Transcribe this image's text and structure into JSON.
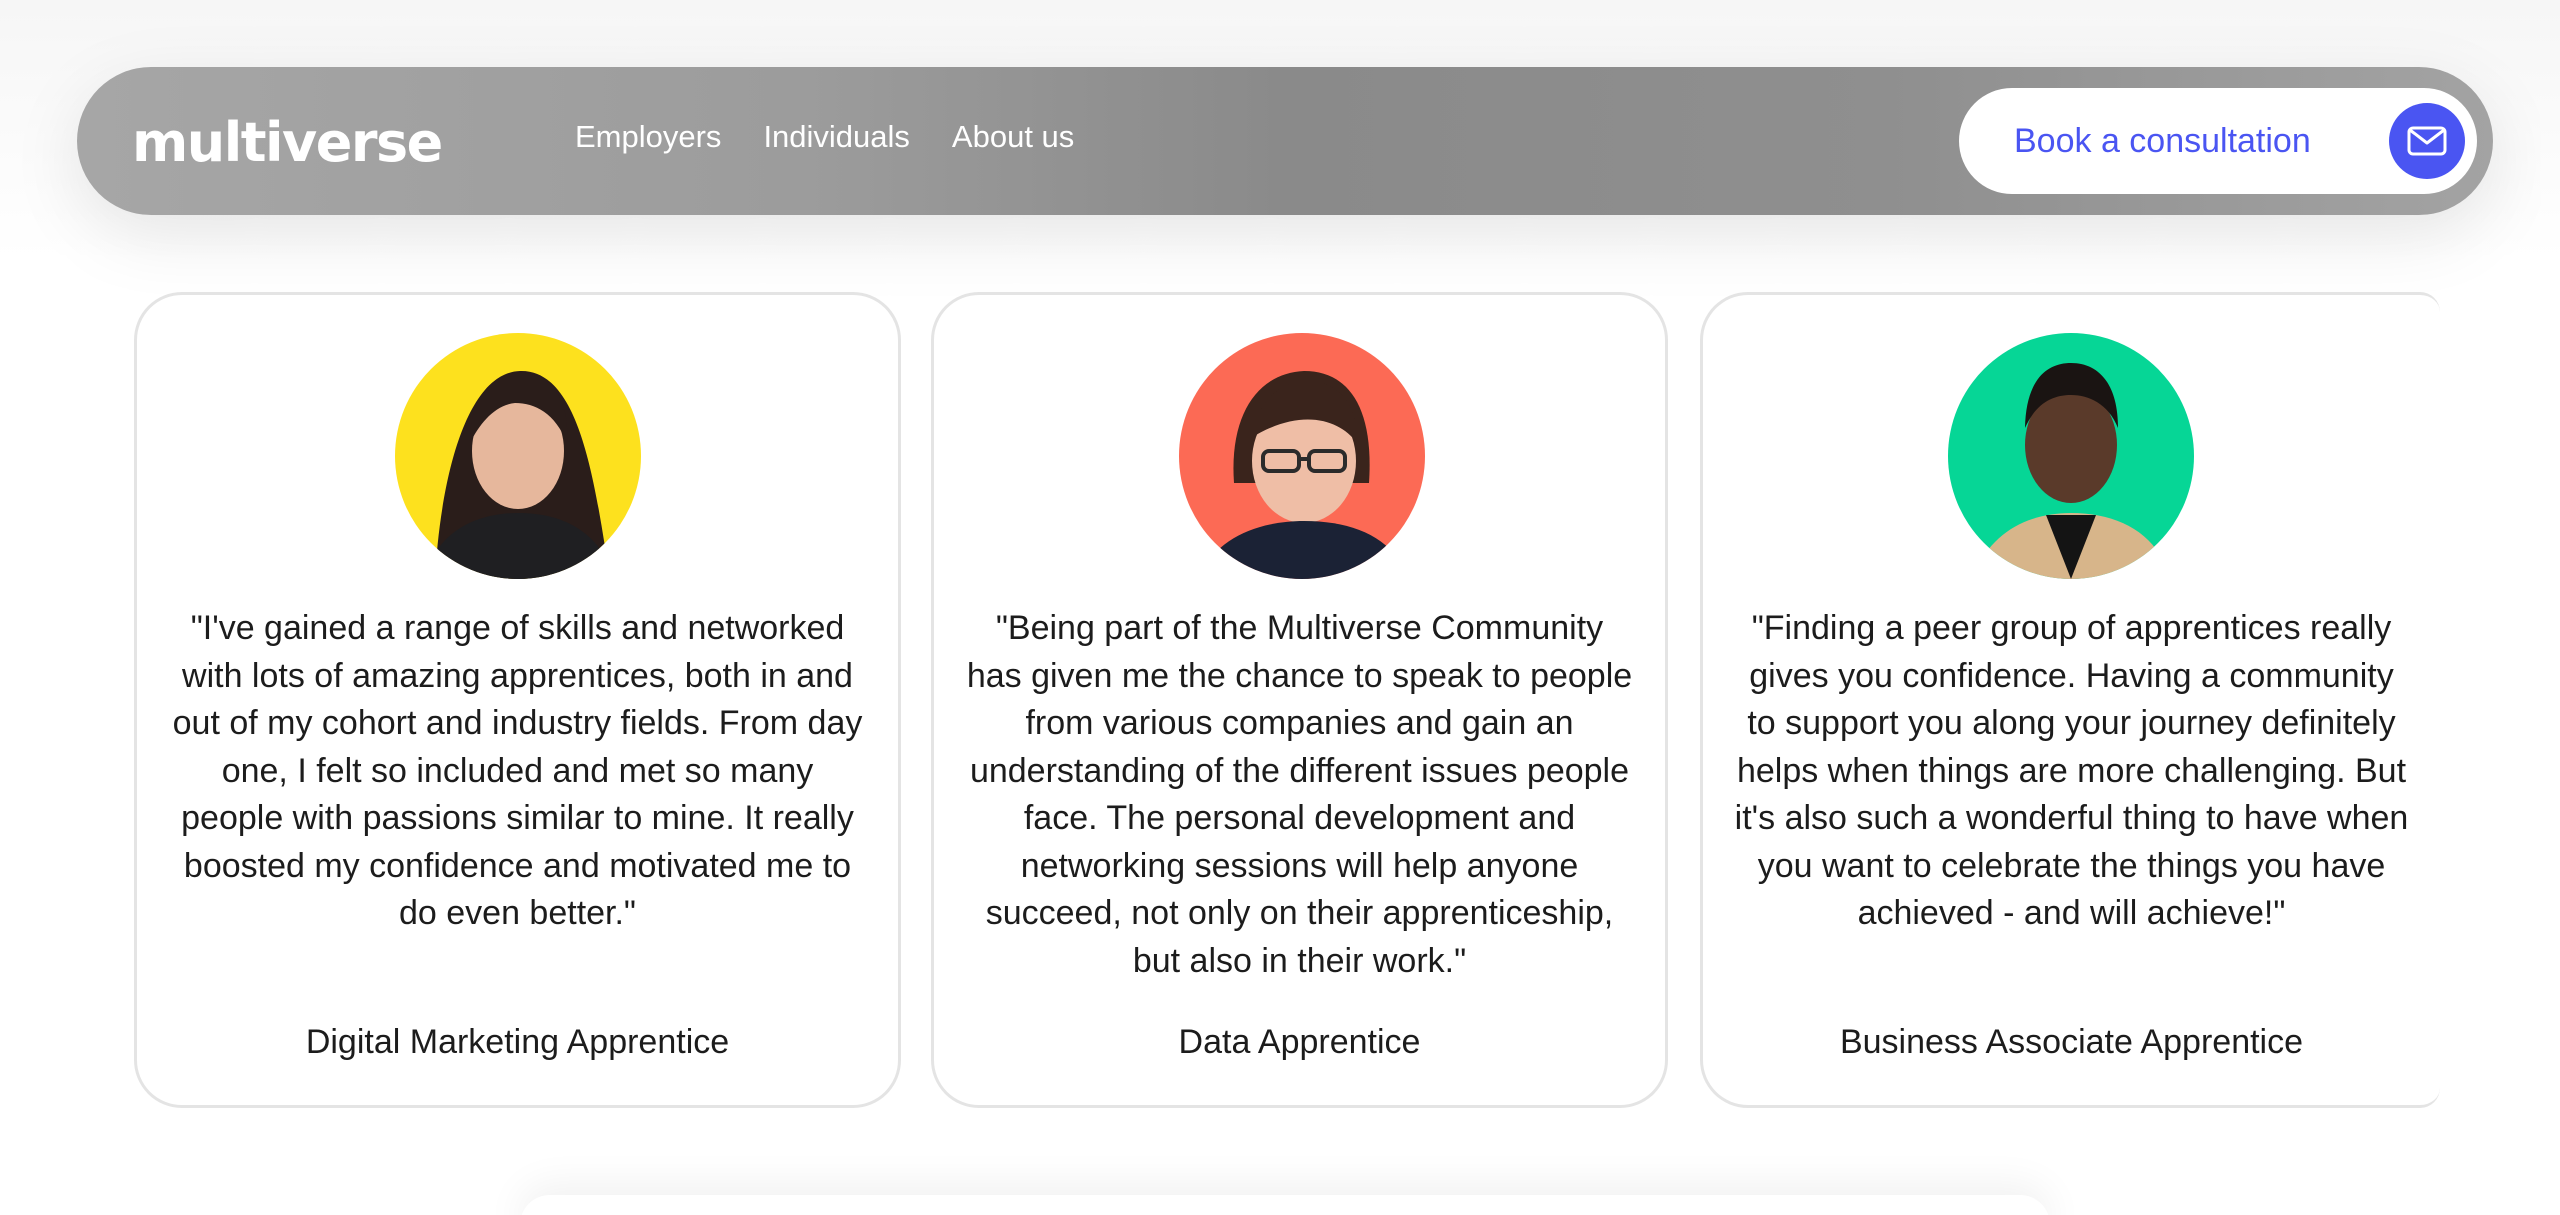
{
  "header": {
    "logo_text": "multiverse",
    "nav": [
      {
        "label": "Employers"
      },
      {
        "label": "Individuals"
      },
      {
        "label": "About us"
      }
    ],
    "cta": {
      "label": "Book a consultation",
      "icon": "envelope-icon"
    }
  },
  "testimonials": [
    {
      "avatar_bg": "#fde11e",
      "quote": "\"I've gained a range of skills and networked with lots of amazing apprentices, both in and out of my cohort and industry fields. From day one, I felt so included and met so many people with passions similar to mine. It really boosted my confidence and motivated me to do even better.\"",
      "role": "Digital Marketing Apprentice"
    },
    {
      "avatar_bg": "#fc6a55",
      "quote": "\"Being part of the Multiverse Community has given me the chance to speak to people from various companies and gain an understanding of the different issues people face. The personal development and networking sessions will help anyone succeed, not only on their apprenticeship, but also in their work.\"",
      "role": "Data Apprentice"
    },
    {
      "avatar_bg": "#06d696",
      "quote": "\"Finding a peer group of apprentices really gives you confidence. Having a community to support you along your journey definitely helps when things are more challenging. But it's also such a wonderful thing to have when you want to celebrate the things you have achieved - and will achieve!\"",
      "role": "Business Associate Apprentice"
    }
  ],
  "colors": {
    "accent": "#4a55f2",
    "text": "#1c1c1c"
  }
}
